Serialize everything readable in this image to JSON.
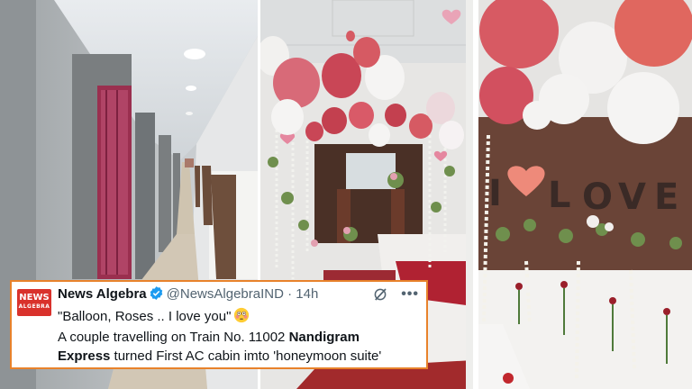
{
  "post": {
    "logo_line1": "NEWS",
    "logo_line2": "ALGEBRA",
    "author_name": "News Algebra",
    "handle": "@NewsAlgebraIND",
    "separator": "·",
    "age": "14h",
    "quote": "\"Balloon, Roses .. I love you\"",
    "body_part1": "A couple travelling on Train No. 11002 ",
    "body_bold1": "Nandigram",
    "body_bold2": "Express",
    "body_part2": " turned First AC cabin imto 'honeymoon suite'",
    "icons": [
      "verified-badge-icon",
      "grok-icon",
      "more-icon",
      "flushed-face-emoji"
    ]
  },
  "decor": {
    "wall_letters": [
      "I",
      "L",
      "O",
      "V",
      "E"
    ]
  },
  "colors": {
    "frame_accent": "#e8822b",
    "logo_red": "#d9322c",
    "verified_blue": "#1d9bf0",
    "text_primary": "#0f1419",
    "text_secondary": "#536471"
  }
}
